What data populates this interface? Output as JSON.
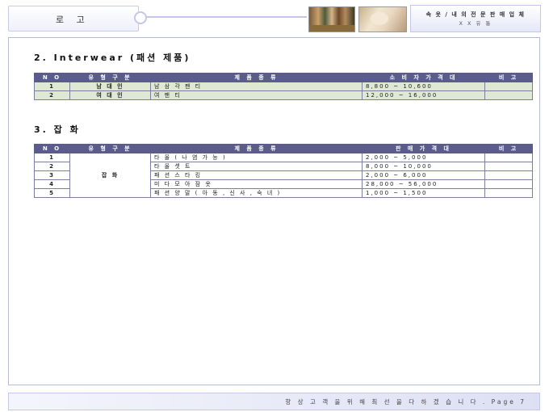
{
  "header": {
    "logo_text": "로 고",
    "company_line1": "속 옷 / 내 의  전 문 판 매  업 체",
    "company_line2": "X X 유 통"
  },
  "section1": {
    "title": "2. Interwear (패션 제품)",
    "columns": [
      "N O",
      "유 형  구 분",
      "제 품  종 류",
      "소 비 자 가 격 대",
      "비 고"
    ],
    "rows": [
      {
        "no": "1",
        "type": "남 대 인",
        "product": "남 삼 각 팬 티",
        "price": "8,800 ~ 10,600",
        "note": ""
      },
      {
        "no": "2",
        "type": "여 대 인",
        "product": "여 팬 티",
        "price": "12,000 ~ 16,000",
        "note": ""
      }
    ]
  },
  "section2": {
    "title": "3. 잡 화",
    "columns": [
      "N O",
      "유 형  구 분",
      "제 품  종 류",
      "판 매 가 격 대",
      "비 고"
    ],
    "group": "잡 화",
    "rows": [
      {
        "no": "1",
        "product": "타 올 ( 나 염  가 능 )",
        "price": "2,000 ~ 5,000",
        "note": ""
      },
      {
        "no": "2",
        "product": "타 올 셋 트",
        "price": "8,000 ~ 10,000",
        "note": ""
      },
      {
        "no": "3",
        "product": "패 션 스 타 킹",
        "price": "2,000 ~ 6,000",
        "note": ""
      },
      {
        "no": "4",
        "product": "미 다 모 아  잠 옷",
        "price": "28,000 ~ 56,000",
        "note": ""
      },
      {
        "no": "5",
        "product": "패 션 양 말 ( 아 동 ,  신 사 ,  숙 녀 )",
        "price": "1,000 ~ 1,500",
        "note": ""
      }
    ]
  },
  "footer": {
    "text": "항 상  고 객 을  위 해  최 선 을  다 하 겠 습 니 다 .  Page 7"
  }
}
